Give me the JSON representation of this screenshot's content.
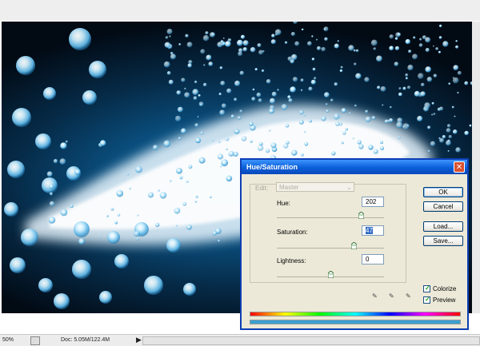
{
  "status": {
    "zoom": "50%",
    "doc_info": "Doc: 5.05M/122.4M",
    "arrow_glyph": "▶"
  },
  "dialog": {
    "title": "Hue/Saturation",
    "close_glyph": "✕",
    "edit_label": "Edit:",
    "edit_value": "Master",
    "hue_label": "Hue:",
    "hue_value": "202",
    "hue_level": 0.78,
    "saturation_label": "Saturation:",
    "saturation_value": "47",
    "saturation_level": 0.72,
    "lightness_label": "Lightness:",
    "lightness_value": "0",
    "lightness_level": 0.5,
    "buttons": {
      "ok": "OK",
      "cancel": "Cancel",
      "load": "Load...",
      "save": "Save..."
    },
    "colorize_label": "Colorize",
    "colorize_checked": true,
    "preview_label": "Preview",
    "preview_checked": true
  },
  "colors": {
    "canvas_glow": "#0f6fa7",
    "bubble": "#9fd6f2",
    "title_blue": "#0a5fd8",
    "tinted_bar": "#3aa0d0"
  }
}
